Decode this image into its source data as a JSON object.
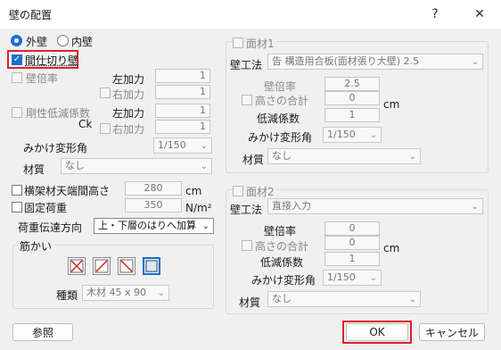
{
  "window": {
    "title": "壁の配置",
    "help": "?",
    "close": "✕"
  },
  "wall_type": {
    "outer": "外壁",
    "inner": "内壁"
  },
  "through_column": "間仕切り壁",
  "ratio": {
    "label": "壁倍率",
    "left": "左加力",
    "right": "右加力",
    "left_val": "1",
    "right_val": "1"
  },
  "stiffness": {
    "label": "剛性低減係数",
    "ck": "Ck",
    "left": "左加力",
    "right": "右加力",
    "left_val": "1",
    "right_val": "1"
  },
  "deform": {
    "label": "みかけ変形角",
    "value": "1/150"
  },
  "material": {
    "label": "材質",
    "value": "なし"
  },
  "height": {
    "label": "横架材天端間高さ",
    "value": "280",
    "unit": "cm"
  },
  "fixed_load": {
    "label": "固定荷重",
    "value": "350",
    "unit": "N/m²"
  },
  "load_dir": {
    "label": "荷重伝達方向",
    "value": "上・下層のはりへ加算"
  },
  "brace": {
    "legend": "筋かい",
    "kind_label": "種類",
    "kind_value": "木材 45 x 90"
  },
  "ref_button": "参照",
  "face1": {
    "legend": "面材1",
    "method_label": "壁工法",
    "method_value": "告 構造用合板(面材張り大壁) 2.5",
    "ratio_label": "壁倍率",
    "ratio_value": "2.5",
    "sum_label": "高さの合計",
    "sum_value": "0",
    "sum_unit": "cm",
    "reduce_label": "低減係数",
    "reduce_value": "1",
    "deform_label": "みかけ変形角",
    "deform_value": "1/150",
    "material_label": "材質",
    "material_value": "なし"
  },
  "face2": {
    "legend": "面材2",
    "method_label": "壁工法",
    "method_value": "直接入力",
    "ratio_label": "壁倍率",
    "ratio_value": "0",
    "sum_label": "高さの合計",
    "sum_value": "0",
    "sum_unit": "cm",
    "reduce_label": "低減係数",
    "reduce_value": "1",
    "deform_label": "みかけ変形角",
    "deform_value": "1/150",
    "material_label": "材質",
    "material_value": "なし"
  },
  "buttons": {
    "ok": "OK",
    "cancel": "キャンセル"
  }
}
